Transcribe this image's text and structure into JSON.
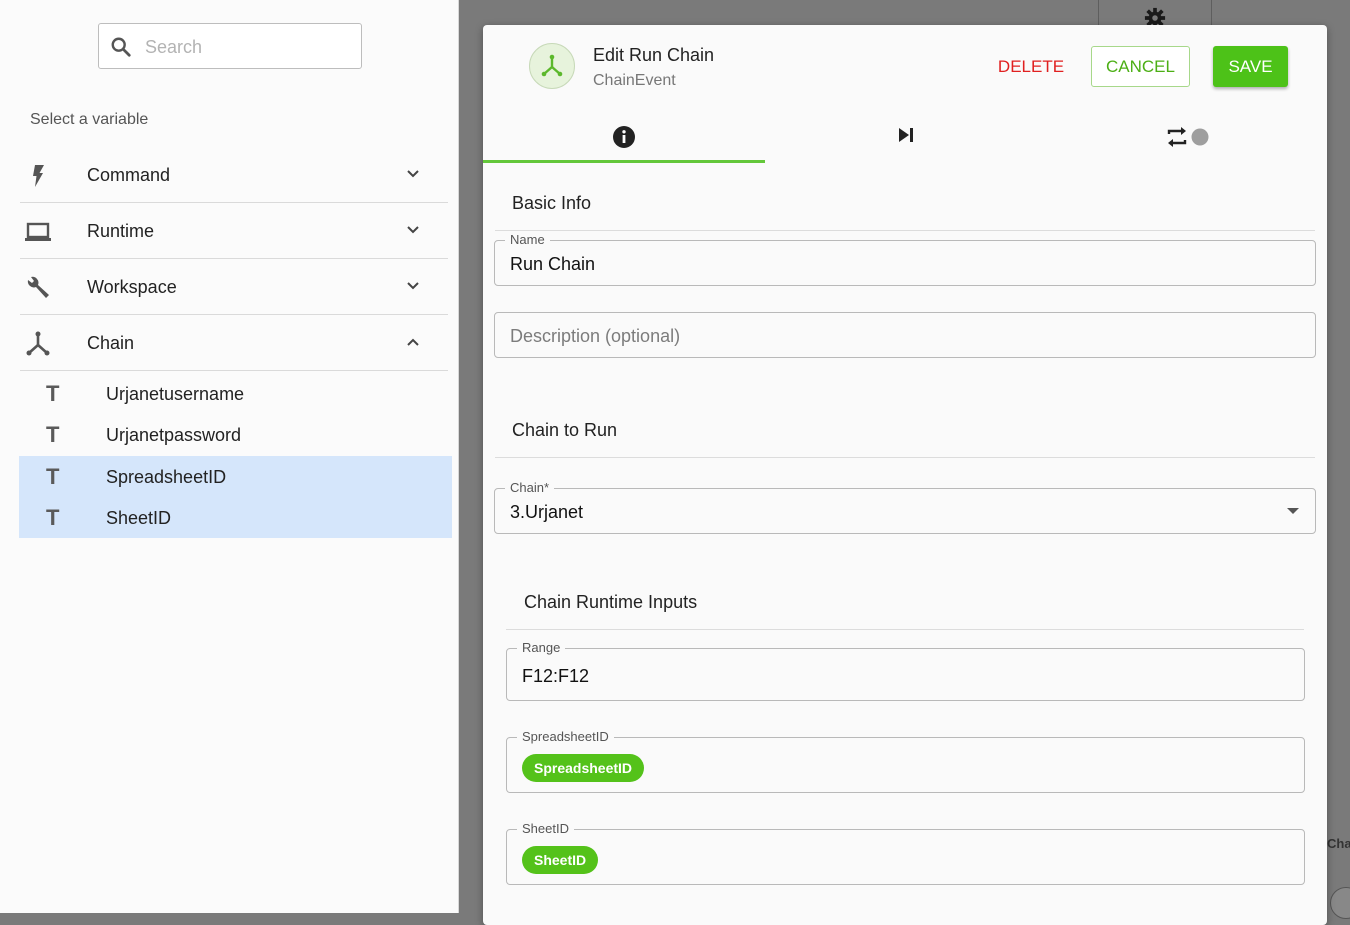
{
  "sidebar": {
    "search_placeholder": "Search",
    "select_label": "Select a variable",
    "categories": [
      {
        "label": "Command",
        "icon": "lightning-icon",
        "expanded": false
      },
      {
        "label": "Runtime",
        "icon": "laptop-icon",
        "expanded": false
      },
      {
        "label": "Workspace",
        "icon": "wrench-icon",
        "expanded": false
      },
      {
        "label": "Chain",
        "icon": "chain-fork-icon",
        "expanded": true
      }
    ],
    "variables": [
      {
        "type_glyph": "T",
        "label": "Urjanetusername",
        "selected": false
      },
      {
        "type_glyph": "T",
        "label": "Urjanetpassword",
        "selected": false
      },
      {
        "type_glyph": "T",
        "label": "SpreadsheetID",
        "selected": true
      },
      {
        "type_glyph": "T",
        "label": "SheetID",
        "selected": true
      }
    ]
  },
  "background": {
    "right_edge_text": "Cha"
  },
  "dialog": {
    "title": "Edit Run Chain",
    "subtitle": "ChainEvent",
    "delete_label": "DELETE",
    "cancel_label": "CANCEL",
    "save_label": "SAVE",
    "tabs": [
      {
        "icon": "info-icon",
        "active": true
      },
      {
        "icon": "skip-next-icon",
        "active": false
      },
      {
        "icon": "repeat-icon",
        "active": false
      }
    ],
    "basic_info_heading": "Basic Info",
    "name_label": "Name",
    "name_value": "Run Chain",
    "description_placeholder": "Description (optional)",
    "chain_to_run_heading": "Chain to Run",
    "chain_label": "Chain*",
    "chain_value": "3.Urjanet",
    "runtime_inputs_heading": "Chain Runtime Inputs",
    "range_label": "Range",
    "range_value": "F12:F12",
    "spreadsheet_label": "SpreadsheetID",
    "spreadsheet_chip": "SpreadsheetID",
    "sheet_label": "SheetID",
    "sheet_chip": "SheetID"
  },
  "colors": {
    "accent_green": "#4dc218",
    "delete_red": "#e02020",
    "selected_row": "#d5e6fb"
  }
}
